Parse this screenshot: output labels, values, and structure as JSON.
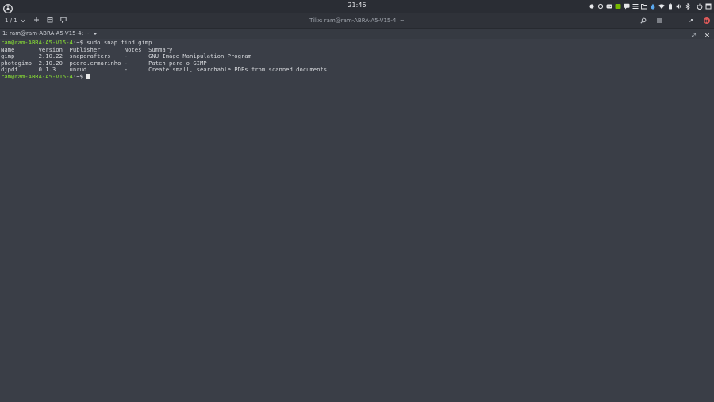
{
  "topbar": {
    "clock": "21:46",
    "tray_icons": [
      "record-icon",
      "ring-icon",
      "game-controller-icon",
      "nvidia-icon",
      "chat-icon",
      "menu-lines-icon",
      "files-icon",
      "drop-icon",
      "wifi-icon",
      "battery-icon",
      "volume-icon",
      "bluetooth-icon",
      "power-icon",
      "window-icon"
    ]
  },
  "headerbar": {
    "session_label": "1 / 1",
    "window_title": "Tilix: ram@ram-ABRA-A5-V15-4: ~"
  },
  "terminal_tab": {
    "title": "1: ram@ram-ABRA-A5-V15-4: ~"
  },
  "terminal": {
    "prompt": "ram@ram-ABRA-A5-V15-4",
    "path_suffix": ":~$",
    "command": " sudo snap find gimp",
    "header": "Name       Version  Publisher       Notes  Summary",
    "rows": [
      "gimp       2.10.22  snapcrafters    -      GNU Image Manipulation Program",
      "photogimp  2.10.20  pedro.ermarinho -      Patch para o GIMP",
      "djpdf      0.1.3    unrud           -      Create small, searchable PDFs from scanned documents"
    ]
  },
  "colors": {
    "background": "#3a3e47",
    "prompt": "#8ae234",
    "close": "#e05a5a"
  }
}
